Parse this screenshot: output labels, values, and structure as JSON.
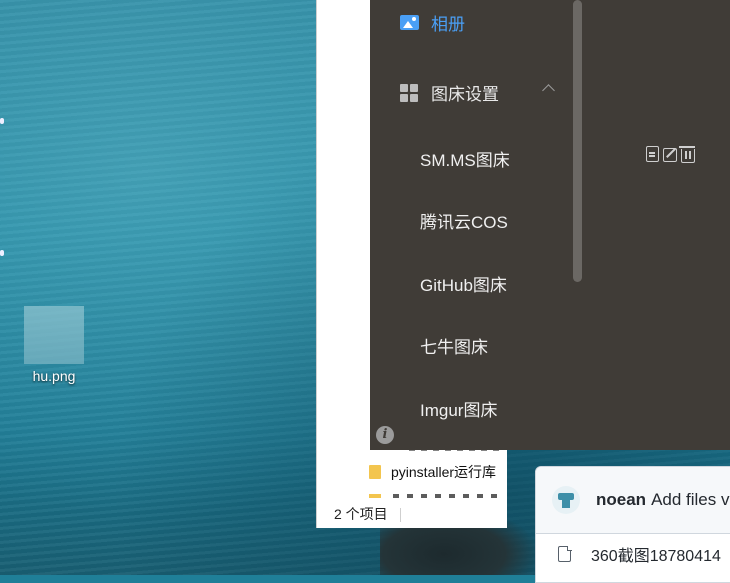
{
  "desktop": {
    "icon_label": "hu.png"
  },
  "explorer": {
    "folder_name": "pyinstaller运行库",
    "status_text": "2 个项目"
  },
  "sidebar": {
    "album_label": "相册",
    "picbed_settings_label": "图床设置",
    "picbed_items": [
      "SM.MS图床",
      "腾讯云COS",
      "GitHub图床",
      "七牛图床",
      "Imgur图床"
    ],
    "info_label": "i"
  },
  "github": {
    "username": "noean",
    "commit_message": "Add files v",
    "file_name": "360截图18780414"
  },
  "colors": {
    "sidebar_bg": "#403c37",
    "accent": "#4a9ff5"
  }
}
